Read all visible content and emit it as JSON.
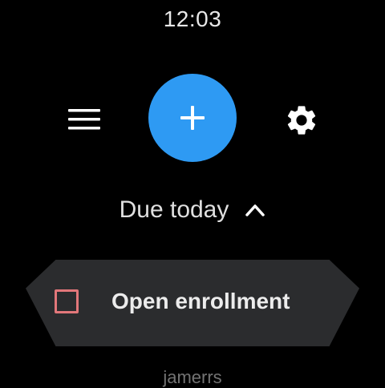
{
  "status_bar": {
    "time": "12:03"
  },
  "toolbar": {
    "menu_icon": "hamburger-menu-icon",
    "add_icon": "plus-icon",
    "settings_icon": "gear-icon",
    "add_button_color": "#2e9af3"
  },
  "section": {
    "title": "Due today",
    "toggle_icon": "chevron-up-icon"
  },
  "tasks": [
    {
      "label": "Open enrollment",
      "checked": false,
      "checkbox_color": "#e2777a"
    }
  ],
  "next_item": {
    "label": "jamerrs"
  }
}
